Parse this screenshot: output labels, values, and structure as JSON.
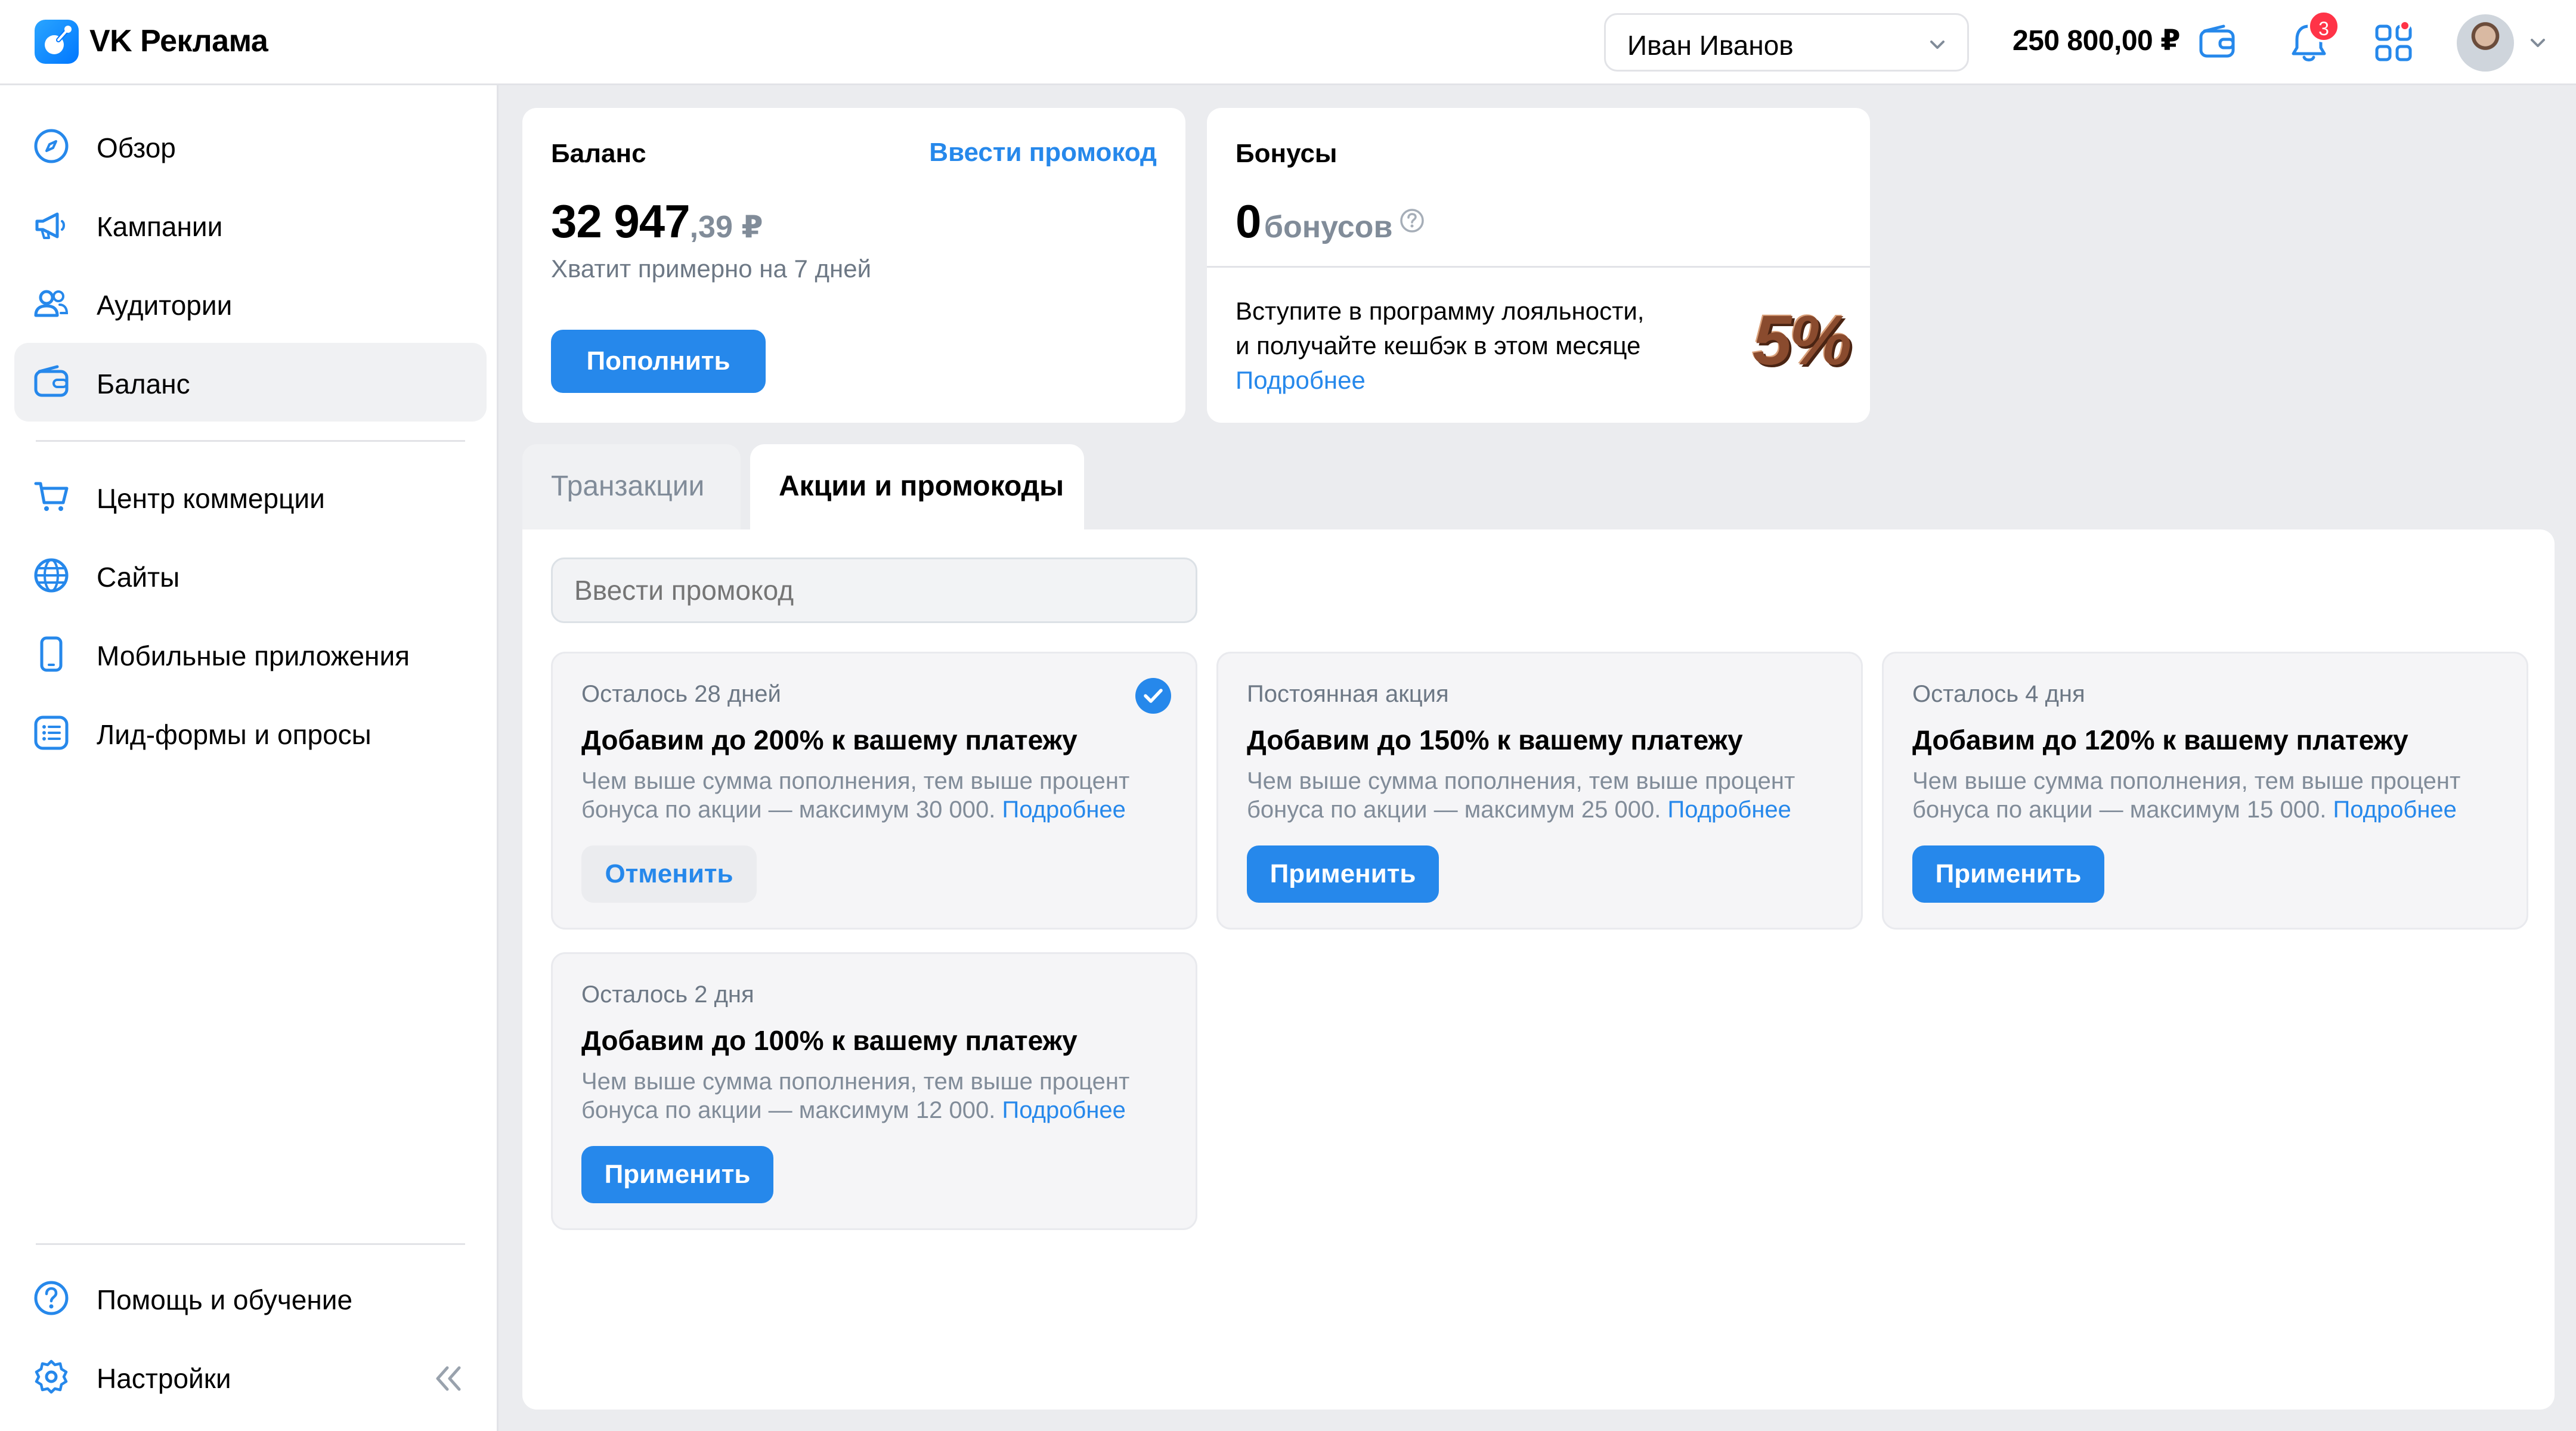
{
  "header": {
    "brand": "VK Реклама",
    "account_name": "Иван Иванов",
    "balance": "250 800,00 ₽",
    "notifications_count": "3"
  },
  "sidebar": {
    "items": [
      {
        "label": "Обзор",
        "icon": "compass-icon"
      },
      {
        "label": "Кампании",
        "icon": "megaphone-icon"
      },
      {
        "label": "Аудитории",
        "icon": "users-icon"
      },
      {
        "label": "Баланс",
        "icon": "wallet-icon",
        "active": true
      },
      {
        "label": "Центр коммерции",
        "icon": "cart-icon"
      },
      {
        "label": "Сайты",
        "icon": "globe-icon"
      },
      {
        "label": "Мобильные приложения",
        "icon": "phone-icon"
      },
      {
        "label": "Лид-формы и опросы",
        "icon": "list-icon"
      }
    ],
    "footer": [
      {
        "label": "Помощь и обучение",
        "icon": "help-icon"
      },
      {
        "label": "Настройки",
        "icon": "gear-icon"
      }
    ]
  },
  "balance_card": {
    "title": "Баланс",
    "promo_link": "Ввести промокод",
    "amount_main": "32 947",
    "amount_fraction": ",39 ₽",
    "hint": "Хватит примерно на 7 дней",
    "topup_button": "Пополнить"
  },
  "bonus_card": {
    "title": "Бонусы",
    "amount": "0",
    "unit": "бонусов",
    "loyalty_text_1": "Вступите в программу лояльности,",
    "loyalty_text_2": "и получайте кешбэк в этом месяце",
    "more_link": "Подробнее",
    "cashback_badge": "5%"
  },
  "tabs": [
    {
      "label": "Транзакции",
      "active": false
    },
    {
      "label": "Акции и промокоды",
      "active": true
    }
  ],
  "promo_input": {
    "placeholder": "Ввести промокод"
  },
  "offers": [
    {
      "meta": "Осталось 28 дней",
      "title": "Добавим до 200% к вашему платежу",
      "desc_1": "Чем выше сумма пополнения, тем выше процент",
      "desc_2": "бонуса по акции — максимум 30 000.",
      "more": "Подробнее",
      "button": "Отменить",
      "applied": true
    },
    {
      "meta": "Постоянная акция",
      "title": "Добавим до 150% к вашему платежу",
      "desc_1": "Чем выше сумма пополнения, тем выше процент",
      "desc_2": "бонуса по акции — максимум 25 000.",
      "more": "Подробнее",
      "button": "Применить",
      "applied": false
    },
    {
      "meta": "Осталось 4 дня",
      "title": "Добавим до 120% к вашему платежу",
      "desc_1": "Чем выше сумма пополнения, тем выше процент",
      "desc_2": "бонуса по акции — максимум 15 000.",
      "more": "Подробнее",
      "button": "Применить",
      "applied": false
    },
    {
      "meta": "Осталось 2 дня",
      "title": "Добавим до 100% к вашему платежу",
      "desc_1": "Чем выше сумма пополнения, тем выше процент",
      "desc_2": "бонуса по акции — максимум 12 000.",
      "more": "Подробнее",
      "button": "Применить",
      "applied": false
    }
  ],
  "colors": {
    "accent": "#2688EB",
    "badge": "#FF3347",
    "background": "#EBECEF"
  }
}
